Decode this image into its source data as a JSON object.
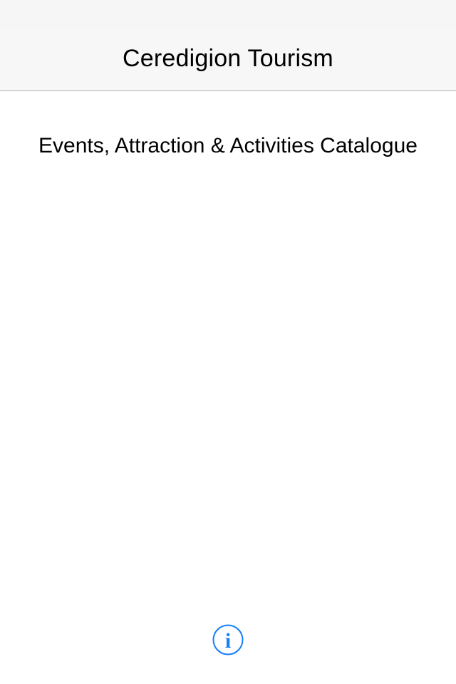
{
  "nav_bar": {
    "title": "Ceredigion Tourism"
  },
  "main": {
    "heading": "Events, Attraction & Activities Catalogue"
  },
  "footer": {
    "info_icon": "info-icon",
    "info_glyph": "i"
  },
  "colors": {
    "accent": "#157efb",
    "nav_background": "#f7f7f7",
    "separator": "#b2b2b2"
  }
}
